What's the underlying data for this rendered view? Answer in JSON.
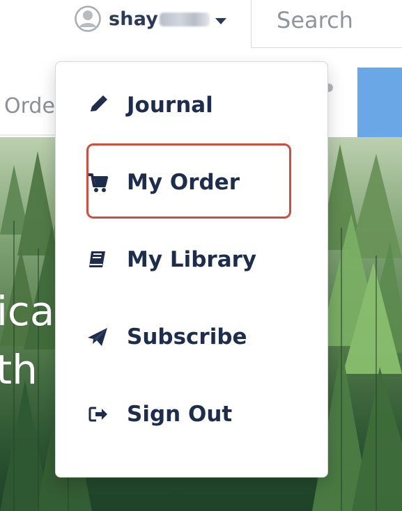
{
  "header": {
    "username_visible": "shay",
    "search": {
      "placeholder": "Search"
    }
  },
  "nav": {
    "left_link": "Orde"
  },
  "hero": {
    "line1": "pica",
    "line2": "vth"
  },
  "dropdown": {
    "items": [
      {
        "label": "Journal",
        "icon": "pencil-icon"
      },
      {
        "label": "My Order",
        "icon": "cart-icon"
      },
      {
        "label": "My Library",
        "icon": "book-icon"
      },
      {
        "label": "Subscribe",
        "icon": "paper-plane-icon"
      },
      {
        "label": "Sign Out",
        "icon": "sign-out-icon"
      }
    ]
  },
  "colors": {
    "menu_text": "#1d2d4e",
    "accent_blue": "#6aa7e6",
    "highlight": "#d24d3f",
    "search_placeholder": "#8f959d"
  }
}
